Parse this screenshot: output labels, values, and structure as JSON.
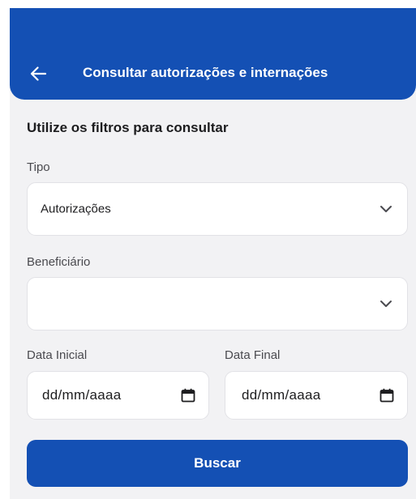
{
  "header": {
    "title": "Consultar autorizações e internações",
    "back_icon": "arrow-left-icon",
    "background_color": "#1450b4"
  },
  "filters": {
    "heading": "Utilize os filtros para consultar",
    "tipo": {
      "label": "Tipo",
      "value": "Autorizações",
      "icon": "chevron-down-icon"
    },
    "beneficiario": {
      "label": "Beneficiário",
      "value": "",
      "icon": "chevron-down-icon"
    },
    "data_inicial": {
      "label": "Data Inicial",
      "placeholder": "dd/mm/aaaa",
      "icon": "calendar-icon"
    },
    "data_final": {
      "label": "Data Final",
      "placeholder": "dd/mm/aaaa",
      "icon": "calendar-icon"
    }
  },
  "actions": {
    "search_label": "Buscar",
    "button_color": "#1450b4"
  }
}
